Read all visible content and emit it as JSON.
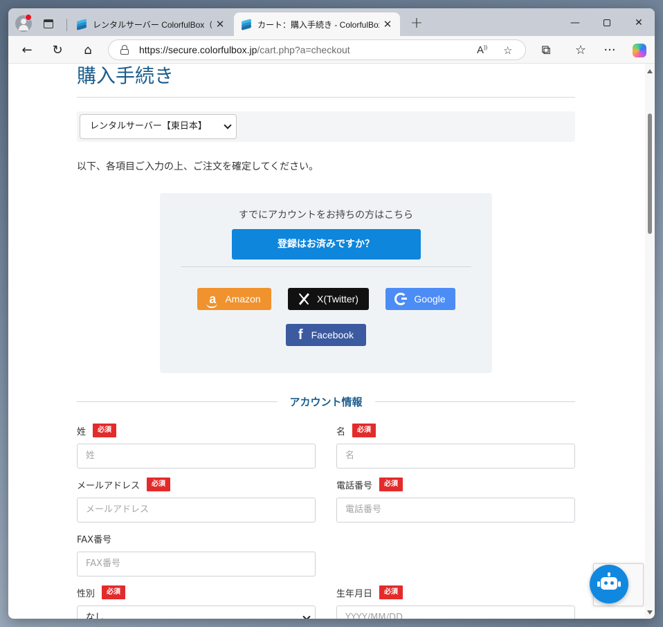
{
  "browser": {
    "tabs": [
      {
        "title": "レンタルサーバー ColorfulBox（カラフル",
        "active": false
      },
      {
        "title": "カート：購入手続き - ColorfulBox",
        "active": true
      }
    ],
    "url_host": "https://secure.colorfulbox.jp",
    "url_path": "/cart.php?a=checkout"
  },
  "page": {
    "title": "購入手続き",
    "product_select": "レンタルサーバー【東日本】",
    "intro": "以下、各項目ご入力の上、ご注文を確定してください。",
    "login": {
      "lead": "すでにアカウントをお持ちの方はこちら",
      "button": "登録はお済みですか？",
      "social": {
        "amazon": "Amazon",
        "x": "X(Twitter)",
        "google": "Google",
        "facebook": "Facebook"
      }
    },
    "account_section": "アカウント情報",
    "required_badge": "必須",
    "fields": {
      "last_name": {
        "label": "姓",
        "placeholder": "姓"
      },
      "first_name": {
        "label": "名",
        "placeholder": "名"
      },
      "email": {
        "label": "メールアドレス",
        "placeholder": "メールアドレス"
      },
      "phone": {
        "label": "電話番号",
        "placeholder": "電話番号"
      },
      "fax": {
        "label": "FAX番号",
        "placeholder": "FAX番号"
      },
      "gender": {
        "label": "性別",
        "value": "なし"
      },
      "birthday": {
        "label": "生年月日",
        "placeholder": "YYYY/MM/DD"
      }
    }
  },
  "colors": {
    "accent": "#0d86dc",
    "title": "#1b5d8c",
    "required": "#e32b2b"
  }
}
